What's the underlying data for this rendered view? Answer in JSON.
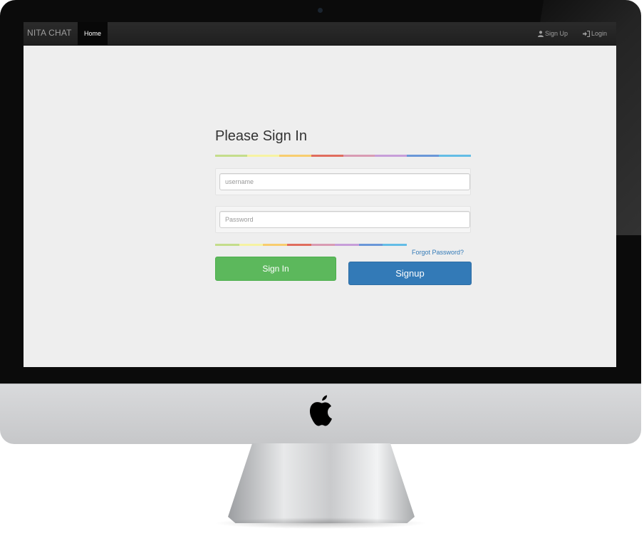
{
  "navbar": {
    "brand": "NITA CHAT",
    "home_label": "Home",
    "signup_label": "Sign Up",
    "login_label": "Login",
    "signup_icon": "user-icon",
    "login_icon": "login-icon"
  },
  "form": {
    "title": "Please Sign In",
    "username_placeholder": "username",
    "password_placeholder": "Password",
    "forgot_label": "Forgot Password?",
    "signin_label": "Sign In",
    "signup_label": "Signup"
  },
  "colors": {
    "rainbow": [
      "#c4dd8b",
      "#f6f3a2",
      "#f8cd6e",
      "#e06d5e",
      "#d99bb3",
      "#c79ed9",
      "#6a97d8",
      "#63bde6"
    ],
    "signin_button": "#5cb85c",
    "signup_button": "#337ab7",
    "navbar": "#222222",
    "page_background": "#eeeeee"
  },
  "device": {
    "logo": "apple-logo"
  }
}
